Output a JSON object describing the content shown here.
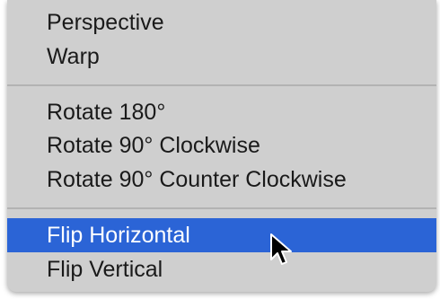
{
  "menu": {
    "items": [
      {
        "label": "Perspective"
      },
      {
        "label": "Warp"
      },
      {
        "label": "Rotate 180°"
      },
      {
        "label": "Rotate 90° Clockwise"
      },
      {
        "label": "Rotate 90° Counter Clockwise"
      },
      {
        "label": "Flip Horizontal"
      },
      {
        "label": "Flip Vertical"
      }
    ],
    "highlighted_item": "Flip Horizontal",
    "colors": {
      "menu_background": "#cfcfcf",
      "highlight": "#2b64d6",
      "text": "#1a1a1a",
      "highlight_text": "#ffffff"
    }
  },
  "cursor": {
    "icon": "mouse-pointer-icon"
  }
}
